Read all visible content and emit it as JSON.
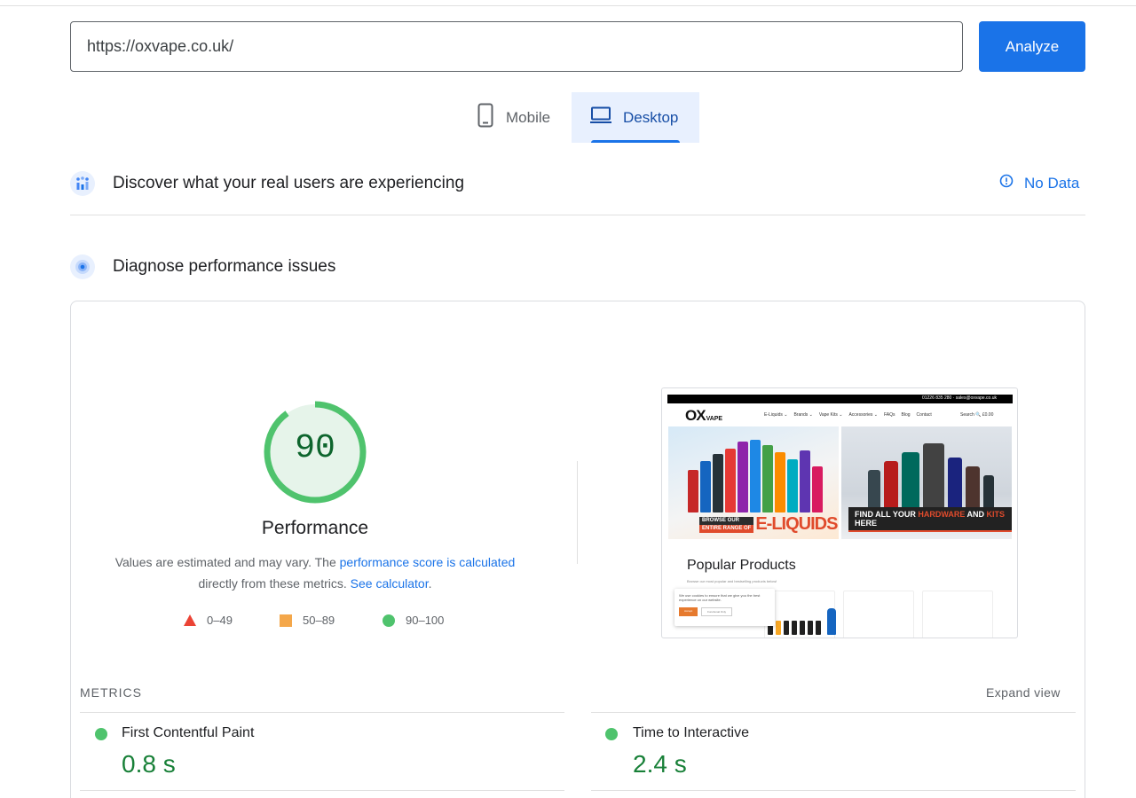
{
  "form": {
    "url_value": "https://oxvape.co.uk/",
    "analyze_label": "Analyze"
  },
  "tabs": [
    {
      "label": "Mobile",
      "icon": "phone-icon",
      "active": false
    },
    {
      "label": "Desktop",
      "icon": "laptop-icon",
      "active": true
    }
  ],
  "field_data": {
    "title": "Discover what your real users are experiencing",
    "status": "No Data"
  },
  "diagnose": {
    "title": "Diagnose performance issues"
  },
  "score": {
    "value": "90",
    "fraction": 0.9,
    "label": "Performance",
    "desc_prefix": "Values are estimated and may vary. The ",
    "desc_link": "performance score is calculated",
    "desc_mid": " directly from these metrics. ",
    "desc_link2": "See calculator",
    "desc_suffix": "."
  },
  "legend": [
    {
      "shape": "triangle",
      "range": "0–49",
      "color": "#eb4335"
    },
    {
      "shape": "square",
      "range": "50–89",
      "color": "#f4a74a"
    },
    {
      "shape": "circle",
      "range": "90–100",
      "color": "#4fc36d"
    }
  ],
  "screenshot": {
    "topbar_text": "01226 835 280  ·  sales@oxvape.co.uk",
    "logo": "OX",
    "logo_sub": "VAPE",
    "nav": [
      "E-Liquids ⌄",
      "Brands ⌄",
      "Vape Kits ⌄",
      "Accessories ⌄",
      "FAQs",
      "Blog",
      "Contact"
    ],
    "search": "Search  🔍  £0.00",
    "banner_left_small1": "BROWSE OUR",
    "banner_left_small2": "ENTIRE RANGE OF",
    "banner_left_big": "E-LIQUIDS",
    "banner_right_pre": "FIND ALL YOUR ",
    "banner_right_hl1": "HARDWARE",
    "banner_right_mid": " AND ",
    "banner_right_hl2": "KITS",
    "banner_right_post": " HERE",
    "popular_title": "Popular Products",
    "popular_sub": "Browse our most popular and bestselling products below!",
    "cookie_text": "We use cookies to ensure that we give you the best experience on our website.",
    "cookie_accept": "Accept",
    "cookie_functional": "Functional Only"
  },
  "metrics": {
    "section_label": "METRICS",
    "expand_label": "Expand view",
    "items": [
      {
        "name": "First Contentful Paint",
        "value": "0.8 s",
        "status": "good"
      },
      {
        "name": "Time to Interactive",
        "value": "2.4 s",
        "status": "good"
      }
    ]
  },
  "colors": {
    "accent": "#1a73e8",
    "pass": "#4fc36d",
    "pass_text": "#0d652d"
  }
}
